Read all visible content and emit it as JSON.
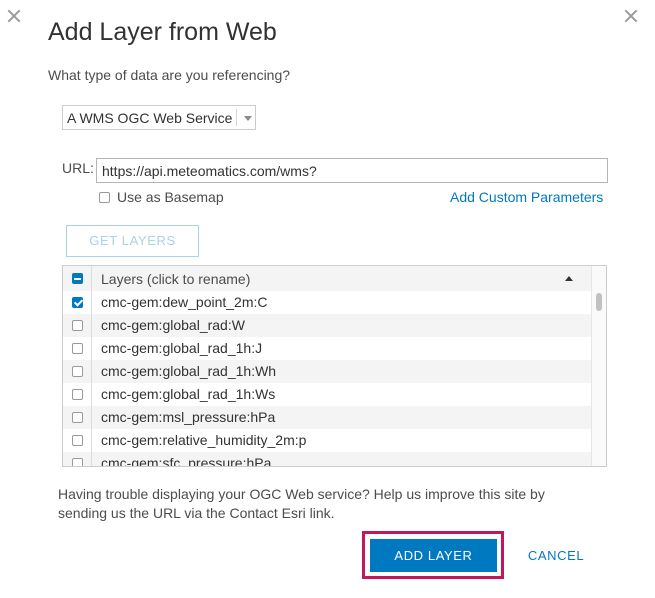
{
  "dialog": {
    "title": "Add Layer from Web",
    "question": "What type of data are you referencing?"
  },
  "data_type": {
    "selected": "A WMS OGC Web Service"
  },
  "url": {
    "label": "URL:",
    "value": "https://api.meteomatics.com/wms?"
  },
  "basemap": {
    "label": "Use as Basemap",
    "checked": false
  },
  "custom_params_label": "Add Custom Parameters",
  "get_layers_label": "GET LAYERS",
  "layers_table": {
    "header": "Layers (click to rename)",
    "rows": [
      {
        "label": "cmc-gem:dew_point_2m:C",
        "checked": true
      },
      {
        "label": "cmc-gem:global_rad:W",
        "checked": false
      },
      {
        "label": "cmc-gem:global_rad_1h:J",
        "checked": false
      },
      {
        "label": "cmc-gem:global_rad_1h:Wh",
        "checked": false
      },
      {
        "label": "cmc-gem:global_rad_1h:Ws",
        "checked": false
      },
      {
        "label": "cmc-gem:msl_pressure:hPa",
        "checked": false
      },
      {
        "label": "cmc-gem:relative_humidity_2m:p",
        "checked": false
      },
      {
        "label": "cmc-gem:sfc_pressure:hPa",
        "checked": false
      }
    ]
  },
  "help_text": "Having trouble displaying your OGC Web service? Help us improve this site by sending us the URL via the Contact Esri link.",
  "buttons": {
    "add_layer": "ADD LAYER",
    "cancel": "CANCEL"
  },
  "colors": {
    "accent": "#0079c1",
    "highlight": "#c2185b",
    "disabled_border": "#a8d2ea"
  }
}
